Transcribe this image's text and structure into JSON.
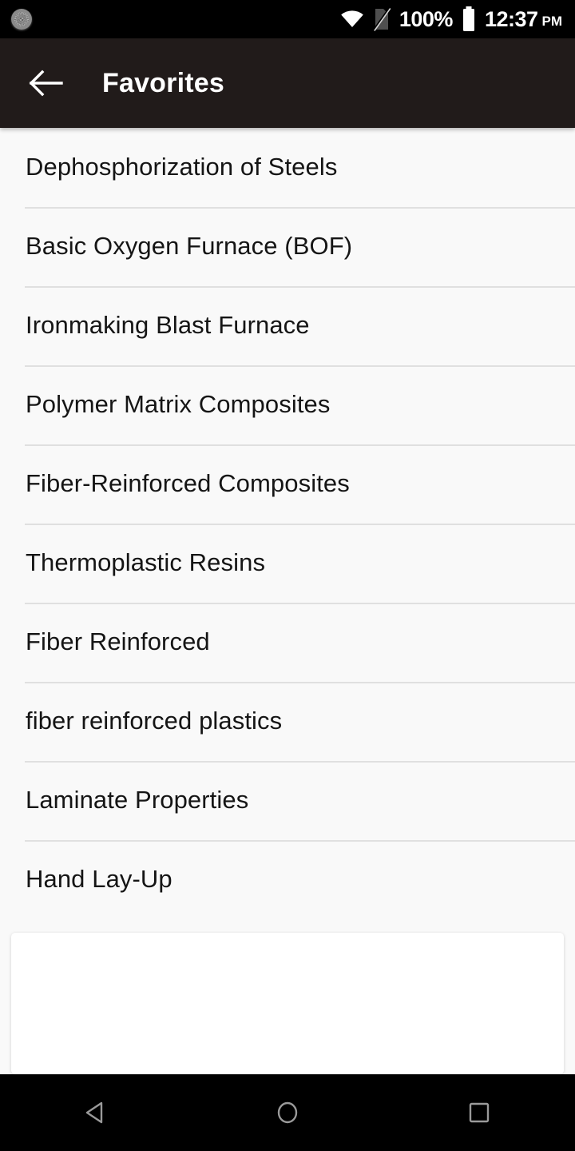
{
  "status_bar": {
    "left_icon": "spinner-icon",
    "wifi_icon": "wifi-icon",
    "cellular_icon": "no-sim-icon",
    "battery_percent": "100%",
    "battery_icon": "battery-full-icon",
    "time": "12:37",
    "am_pm": "PM",
    "background_color": "#000000",
    "foreground_color": "#ffffff"
  },
  "app_bar": {
    "back_icon": "arrow-back-icon",
    "title": "Favorites",
    "background_color": "#211b1a",
    "title_color": "#ffffff"
  },
  "favorites": {
    "items": [
      {
        "label": "Dephosphorization of Steels"
      },
      {
        "label": "Basic Oxygen Furnace (BOF)"
      },
      {
        "label": "Ironmaking Blast Furnace"
      },
      {
        "label": "Polymer Matrix Composites"
      },
      {
        "label": "Fiber-Reinforced Composites"
      },
      {
        "label": "Thermoplastic Resins"
      },
      {
        "label": "Fiber Reinforced"
      },
      {
        "label": "fiber reinforced plastics"
      },
      {
        "label": "Laminate Properties"
      },
      {
        "label": "Hand Lay-Up"
      }
    ],
    "background_color": "#f9f9f9",
    "divider_color": "#e0e0e0",
    "text_color": "#151515"
  },
  "ad_banner": {
    "content": "",
    "background_color": "#ffffff"
  },
  "nav_bar": {
    "back_icon": "triangle-back-icon",
    "home_icon": "circle-home-icon",
    "recents_icon": "square-recents-icon",
    "background_color": "#000000",
    "icon_color": "#9a9a9a"
  }
}
